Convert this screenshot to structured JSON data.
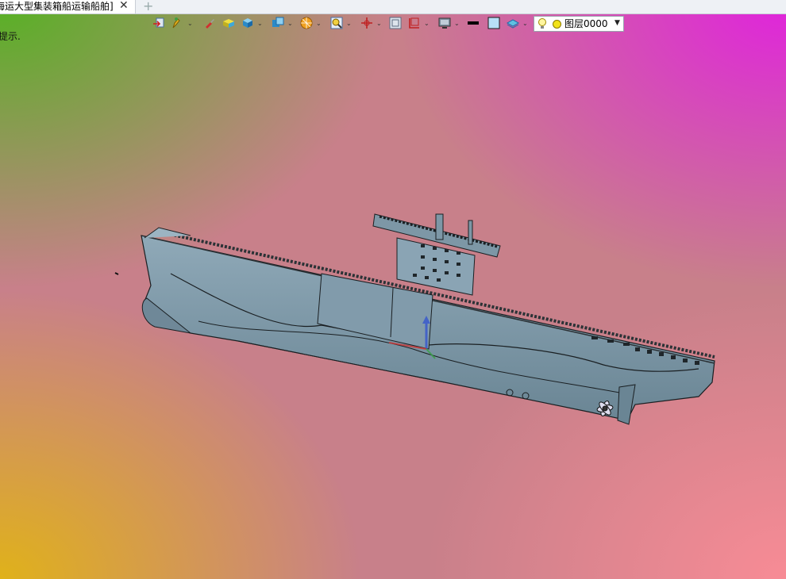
{
  "tab": {
    "title": "海运大型集装箱船运输船舶]",
    "close": "✕",
    "add": "+"
  },
  "hint": "提示.",
  "toolbar": {
    "icons": [
      "import-export-icon",
      "pen-icon",
      "paint-brush-icon",
      "box-solid-icon",
      "cube-icon",
      "view-cube-icon",
      "render-sphere-icon",
      "zoom-icon",
      "pan-axes-icon",
      "frame-icon",
      "clipping-plane-icon",
      "display-mode-icon",
      "line-color-icon",
      "fill-color-icon",
      "layer-visibility-icon"
    ],
    "layer": {
      "name": "图层0000",
      "visible_icon": "bulb-icon",
      "color_icon": "sun-icon"
    }
  },
  "colors": {
    "hull": "#7d97a6",
    "hull_dark": "#5f7886",
    "accent_tab": "#ffffff"
  }
}
